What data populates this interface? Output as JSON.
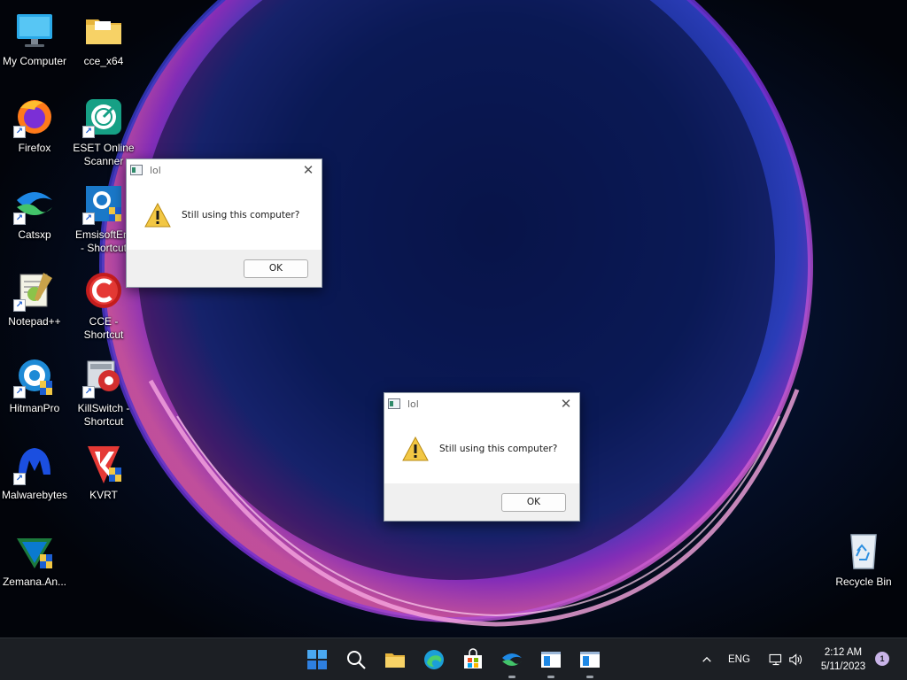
{
  "desktop": {
    "icons": [
      {
        "label": "My Computer",
        "label2": ""
      },
      {
        "label": "cce_x64",
        "label2": ""
      },
      {
        "label": "Firefox",
        "label2": ""
      },
      {
        "label": "ESET Online",
        "label2": "Scanner"
      },
      {
        "label": "Catsxp",
        "label2": ""
      },
      {
        "label": "EmsisoftEm",
        "label2": "- Shortcut"
      },
      {
        "label": "Notepad++",
        "label2": ""
      },
      {
        "label": "CCE -",
        "label2": "Shortcut"
      },
      {
        "label": "HitmanPro",
        "label2": ""
      },
      {
        "label": "KillSwitch -",
        "label2": "Shortcut"
      },
      {
        "label": "Malwarebytes",
        "label2": ""
      },
      {
        "label": "KVRT",
        "label2": ""
      },
      {
        "label": "Zemana.An...",
        "label2": ""
      },
      {
        "label": "Recycle Bin",
        "label2": ""
      }
    ]
  },
  "dialogs": [
    {
      "title": "lol",
      "message": "Still using this computer?",
      "ok_label": "OK"
    },
    {
      "title": "lol",
      "message": "Still using this computer?",
      "ok_label": "OK"
    }
  ],
  "taskbar": {
    "apps": [
      "start-icon",
      "search-icon",
      "file-explorer-icon",
      "edge-icon",
      "store-icon",
      "catsxp-icon",
      "dialog-window-icon",
      "dialog-window-icon"
    ],
    "tray": {
      "language": "ENG",
      "time": "2:12 AM",
      "date": "5/11/2023",
      "notification_count": "1"
    }
  },
  "colors": {
    "taskbar_bg": "#1c1f24",
    "accent": "#2e7fe0",
    "warning": "#f2c744"
  }
}
